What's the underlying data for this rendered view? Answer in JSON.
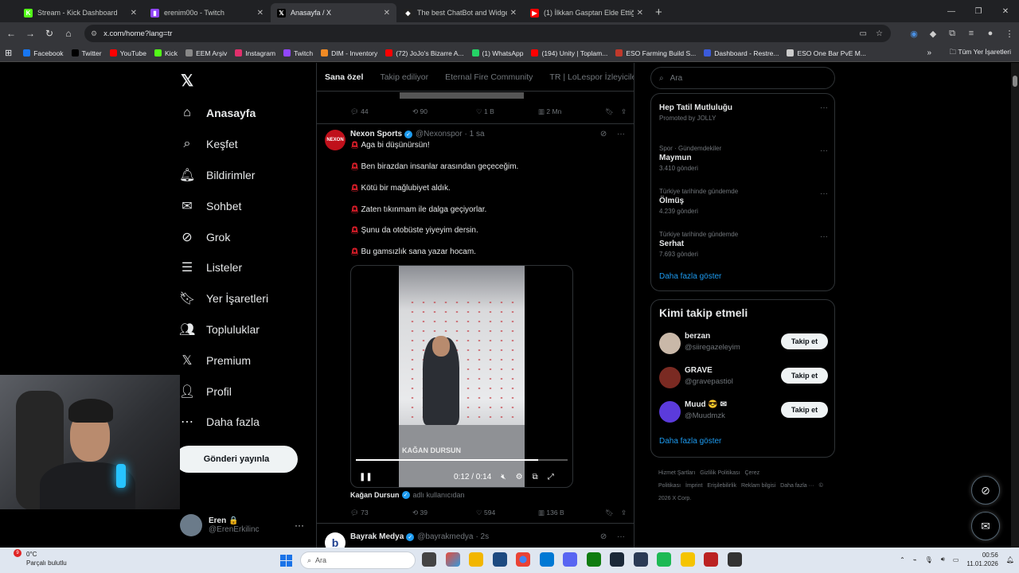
{
  "tabs": [
    {
      "title": "Stream - Kick Dashboard",
      "icon": "kick-icon",
      "color": "#53fc18",
      "glyph": "K"
    },
    {
      "title": "erenim00o - Twitch",
      "icon": "twitch-icon",
      "color": "#9146ff",
      "glyph": "▮"
    },
    {
      "title": "Anasayfa / X",
      "icon": "x-icon",
      "color": "#000000",
      "glyph": "𝕏"
    },
    {
      "title": "The best ChatBot and Widgets",
      "icon": "streamelements-icon",
      "color": "#222222",
      "glyph": "◆"
    },
    {
      "title": "(1) İlkkan Gasptan Elde Ettiği Ge",
      "icon": "youtube-icon",
      "color": "#ff0000",
      "glyph": "▶"
    }
  ],
  "address": {
    "url": "x.com/home?lang=tr"
  },
  "bookmarks": [
    {
      "label": "Facebook",
      "color": "#1877f2"
    },
    {
      "label": "Twitter",
      "color": "#000000"
    },
    {
      "label": "YouTube",
      "color": "#ff0000"
    },
    {
      "label": "Kick",
      "color": "#53fc18"
    },
    {
      "label": "EEM Arşiv",
      "color": "#888888"
    },
    {
      "label": "Instagram",
      "color": "#e1306c"
    },
    {
      "label": "Twitch",
      "color": "#9146ff"
    },
    {
      "label": "DIM - Inventory",
      "color": "#f08a24"
    },
    {
      "label": "(72) JoJo's Bizarre A...",
      "color": "#ff0000"
    },
    {
      "label": "(1) WhatsApp",
      "color": "#25d366"
    },
    {
      "label": "(194) Unity | Toplam...",
      "color": "#ff0000"
    },
    {
      "label": "ESO Farming Build S...",
      "color": "#c0392b"
    },
    {
      "label": "Dashboard - Restre...",
      "color": "#3b5bdb"
    },
    {
      "label": "ESO One Bar PvE M...",
      "color": "#cccccc"
    }
  ],
  "bookmarks_all": "Tüm Yer İşaretleri",
  "nav": [
    {
      "label": "Anasayfa",
      "icon": "home-icon",
      "glyph": "⌂"
    },
    {
      "label": "Keşfet",
      "icon": "search-icon",
      "glyph": "⌕"
    },
    {
      "label": "Bildirimler",
      "icon": "bell-icon",
      "glyph": "🔔︎"
    },
    {
      "label": "Sohbet",
      "icon": "mail-icon",
      "glyph": "✉"
    },
    {
      "label": "Grok",
      "icon": "grok-icon",
      "glyph": "⊘"
    },
    {
      "label": "Listeler",
      "icon": "list-icon",
      "glyph": "☰"
    },
    {
      "label": "Yer İşaretleri",
      "icon": "bookmark-icon",
      "glyph": "🔖︎"
    },
    {
      "label": "Topluluklar",
      "icon": "communities-icon",
      "glyph": "👥︎"
    },
    {
      "label": "Premium",
      "icon": "x-premium-icon",
      "glyph": "𝕏"
    },
    {
      "label": "Profil",
      "icon": "profile-icon",
      "glyph": "👤︎"
    },
    {
      "label": "Daha fazla",
      "icon": "more-icon",
      "glyph": "⋯"
    }
  ],
  "post_button": "Gönderi yayınla",
  "account": {
    "name": "Eren 🔒",
    "handle": "@ErenErkilinc"
  },
  "feed_tabs": [
    "Sana özel",
    "Takip ediliyor",
    "Eternal Fire Community",
    "TR | LoLespor İzleyicile"
  ],
  "prev_actions": {
    "replies": "44",
    "reposts": "90",
    "likes": "1 B",
    "views": "2 Mn"
  },
  "tweet": {
    "avatar_text": "NEXON",
    "name": "Nexon Sports",
    "handle": "@Nexonspor",
    "time": "· 1 sa",
    "lines": [
      "Aga bi düşünürsün!",
      "Ben birazdan insanlar arasından geçeceğim.",
      "Kötü bir mağlubiyet aldık.",
      "Zaten tıkınmam ile dalga geçiyorlar.",
      "Şunu da otobüste yiyeyim dersin.",
      "Bu gamsızlık sana yazar hocam."
    ],
    "video": {
      "time": "0:12 / 0:14",
      "watermark": "KAĞAN DURSUN",
      "progress": 0.86
    },
    "credit_name": "Kağan Dursun",
    "credit_user": "adlı kullanıcıdan",
    "actions": {
      "replies": "73",
      "reposts": "39",
      "likes": "594",
      "views": "136 B"
    }
  },
  "tweet2": {
    "name": "Bayrak Medya",
    "handle": "@bayrakmedya",
    "time": "· 2s"
  },
  "search_placeholder": "Ara",
  "trends": [
    {
      "context": "",
      "title": "Hep Tatil Mutluluğu",
      "count": "Promoted by JOLLY"
    },
    {
      "context": "Spor · Gündemdekiler",
      "title": "Maymun",
      "count": "3.410 gönderi"
    },
    {
      "context": "Türkiye tarihinde gündemde",
      "title": "Ölmüş",
      "count": "4.239 gönderi"
    },
    {
      "context": "Türkiye tarihinde gündemde",
      "title": "Serhat",
      "count": "7.693 gönderi"
    }
  ],
  "trends_more": "Daha fazla göster",
  "who_title": "Kimi takip etmeli",
  "who": [
    {
      "name": "berzan",
      "handle": "@siiregazeleyim",
      "color": "#c9b8a8"
    },
    {
      "name": "GRAVE",
      "handle": "@gravepastiol",
      "color": "#7a2a22"
    },
    {
      "name": "Muud 😎 ✉",
      "handle": "@Muudmzk",
      "color": "#5b3bdb"
    }
  ],
  "follow_label": "Takip et",
  "who_more": "Daha fazla göster",
  "footer": [
    "Hizmet Şartları",
    "Gizlilik Politikası",
    "Çerez Politikası",
    "İmprint",
    "Erişilebilirlik",
    "Reklam bilgisi",
    "Daha fazla ···",
    "© 2026 X Corp."
  ],
  "taskbar": {
    "temp": "0°C",
    "weather": "Parçalı bulutlu",
    "badge": "9",
    "search": "Ara",
    "time": "00:56",
    "date": "11.01.2026"
  }
}
